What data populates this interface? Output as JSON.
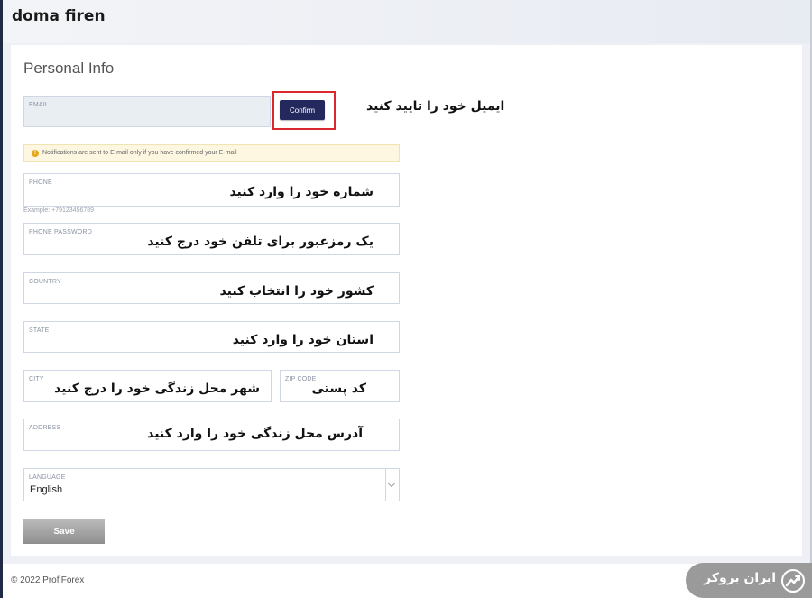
{
  "header": {
    "brand": "doma firen"
  },
  "form": {
    "title": "Personal Info",
    "email": {
      "label": "EMAIL",
      "value": ""
    },
    "confirm_label": "Confirm",
    "email_annotation": "ایمیل خود را تایید کنید",
    "notice": "Notifications are sent to E-mail only if you have confirmed your E-mail",
    "phone": {
      "label": "PHONE",
      "value": "شماره خود را وارد کنید",
      "example": "Example: +79123456789"
    },
    "phone_password": {
      "label": "PHONE PASSWORD",
      "value": "یک رمزعبور برای تلفن خود درج کنید"
    },
    "country": {
      "label": "COUNTRY",
      "value": "کشور خود را انتخاب کنید"
    },
    "state": {
      "label": "STATE",
      "value": "استان خود را وارد کنید"
    },
    "city": {
      "label": "CITY",
      "value": "شهر محل زندگی خود را درج کنید"
    },
    "zip": {
      "label": "ZIP CODE",
      "value": "کد پستی"
    },
    "address": {
      "label": "ADDRESS",
      "value": "آدرس محل زندگی خود را وارد کنید"
    },
    "language": {
      "label": "LANGUAGE",
      "value": "English"
    },
    "save_label": "Save"
  },
  "footer": {
    "copyright": "© 2022 ProfiForex"
  },
  "watermark": {
    "text": "ایران بروکر"
  }
}
